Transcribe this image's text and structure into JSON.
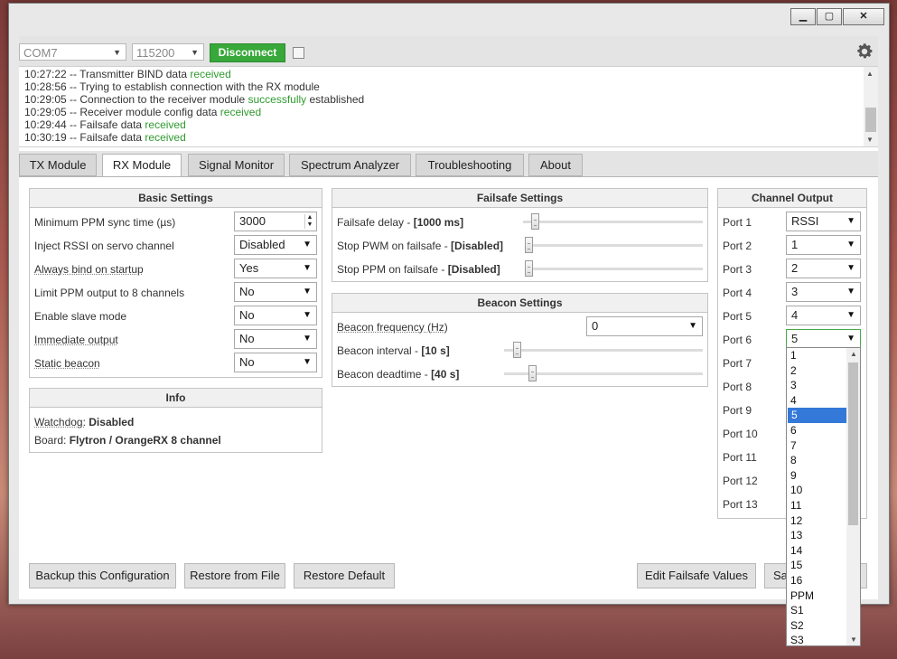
{
  "window": {
    "minimize": "▁",
    "maximize": "▢",
    "close": "✕"
  },
  "topbar": {
    "port": "COM7",
    "baud": "115200",
    "disconnect_label": "Disconnect",
    "settings_icon": "gear-icon"
  },
  "log": [
    {
      "t": "10:27:22 -- Transmitter BIND data ",
      "g": "received",
      "r": ""
    },
    {
      "t": "10:28:56 -- Trying to establish connection with the RX module",
      "g": "",
      "r": ""
    },
    {
      "t": "10:29:05 -- Connection to the receiver module ",
      "g": "successfully",
      "r": " established"
    },
    {
      "t": "10:29:05 -- Receiver module config data ",
      "g": "received",
      "r": ""
    },
    {
      "t": "10:29:44 -- Failsafe data ",
      "g": "received",
      "r": ""
    },
    {
      "t": "10:30:19 -- Failsafe data ",
      "g": "received",
      "r": ""
    }
  ],
  "tabs": [
    "TX Module",
    "RX Module",
    "Signal Monitor",
    "Spectrum Analyzer",
    "Troubleshooting",
    "About"
  ],
  "basic": {
    "title": "Basic Settings",
    "rows": [
      {
        "label": "Minimum PPM sync time (µs)",
        "value": "3000"
      },
      {
        "label": "Inject RSSI on servo channel",
        "value": "Disabled"
      },
      {
        "label": "Always bind on startup",
        "value": "Yes"
      },
      {
        "label": "Limit PPM output to 8 channels",
        "value": "No"
      },
      {
        "label": "Enable slave mode",
        "value": "No"
      },
      {
        "label": "Immediate output",
        "value": "No"
      },
      {
        "label": "Static beacon",
        "value": "No"
      }
    ]
  },
  "info": {
    "title": "Info",
    "watchdog_label": "Watchdog:",
    "watchdog_value": "Disabled",
    "board_label": "Board:",
    "board_value": "Flytron / OrangeRX 8 channel"
  },
  "failsafe": {
    "title": "Failsafe Settings",
    "delay_label": "Failsafe delay - ",
    "delay_value": "[1000 ms]",
    "pwm_label": "Stop PWM on failsafe - ",
    "pwm_value": "[Disabled]",
    "ppm_label": "Stop PPM on failsafe - ",
    "ppm_value": "[Disabled]"
  },
  "beacon": {
    "title": "Beacon Settings",
    "freq_label": "Beacon frequency (Hz)",
    "freq_value": "0",
    "interval_label": "Beacon interval - ",
    "interval_value": "[10 s]",
    "deadtime_label": "Beacon deadtime - ",
    "deadtime_value": "[40 s]"
  },
  "channel": {
    "title": "Channel Output",
    "ports": [
      {
        "label": "Port 1",
        "value": "RSSI"
      },
      {
        "label": "Port 2",
        "value": "1"
      },
      {
        "label": "Port 3",
        "value": "2"
      },
      {
        "label": "Port 4",
        "value": "3"
      },
      {
        "label": "Port 5",
        "value": "4"
      },
      {
        "label": "Port 6",
        "value": "5"
      },
      {
        "label": "Port 7",
        "value": ""
      },
      {
        "label": "Port 8",
        "value": ""
      },
      {
        "label": "Port 9",
        "value": ""
      },
      {
        "label": "Port 10",
        "value": ""
      },
      {
        "label": "Port 11",
        "value": ""
      },
      {
        "label": "Port 12",
        "value": ""
      },
      {
        "label": "Port 13",
        "value": ""
      }
    ]
  },
  "dropdown_options": [
    "1",
    "2",
    "3",
    "4",
    "5",
    "6",
    "7",
    "8",
    "9",
    "10",
    "11",
    "12",
    "13",
    "14",
    "15",
    "16",
    "PPM",
    "S1",
    "S2",
    "S3"
  ],
  "dropdown_selected": "5",
  "footer": {
    "backup": "Backup this Configuration",
    "restore_file": "Restore from File",
    "restore_default": "Restore Default",
    "edit_failsafe": "Edit Failsafe Values",
    "save": "Sa"
  }
}
